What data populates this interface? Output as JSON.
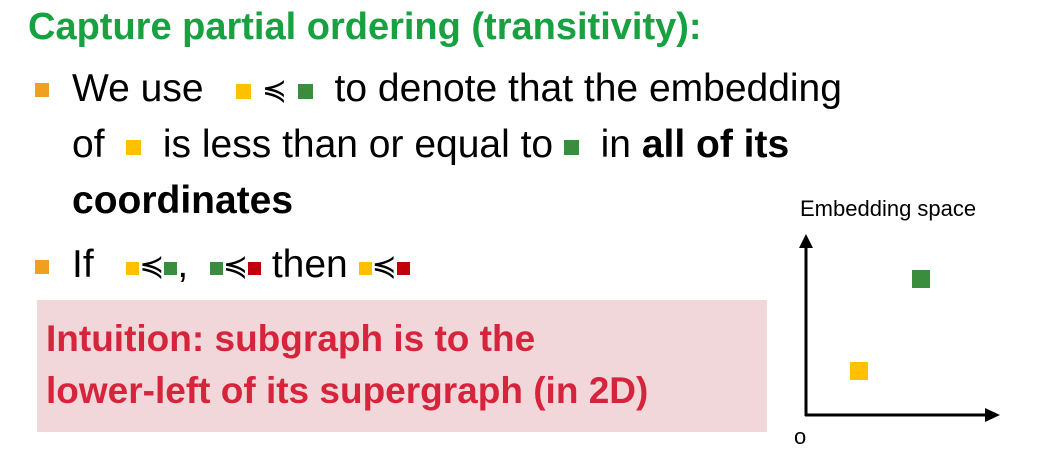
{
  "title": "Capture partial ordering (transitivity):",
  "bullet1": {
    "line1_a": "We use",
    "line1_b": "to denote that the embedding",
    "line2_a": "of",
    "line2_b": "is less than or equal to",
    "line2_c": "in",
    "line2_bold": "all of its",
    "line3_bold": "coordinates"
  },
  "bullet2": {
    "prefix": "If",
    "comma": ",",
    "then": "then"
  },
  "relation_symbol": "≼",
  "intuition": {
    "line1": "Intuition: subgraph is to the",
    "line2": "lower-left of its supergraph (in 2D)"
  },
  "diagram": {
    "label": "Embedding space",
    "origin": "o"
  },
  "colors": {
    "title_green": "#17a140",
    "bullet_orange": "#f0a020",
    "yellow": "#ffc000",
    "green": "#3b8d3e",
    "red": "#c0000a",
    "intuition_bg": "#f1d7d9",
    "intuition_text": "#d5243c"
  },
  "icons": [
    "bullet-square-icon",
    "yellow-square-icon",
    "green-square-icon",
    "red-square-icon",
    "axis-arrow-icon"
  ]
}
